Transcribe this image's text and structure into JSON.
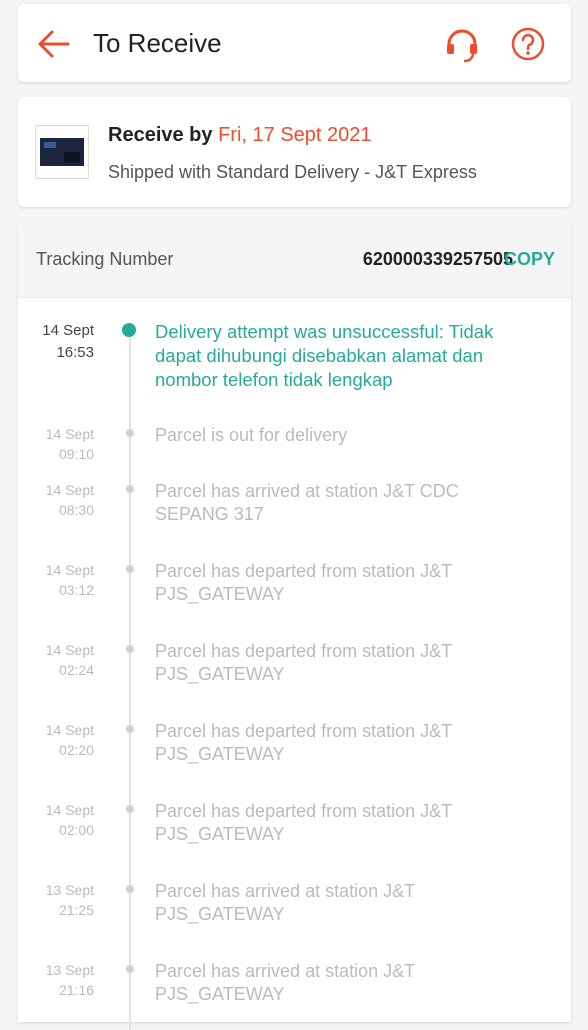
{
  "header": {
    "title": "To Receive"
  },
  "delivery": {
    "receive_by_label": "Receive by",
    "receive_date": "Fri, 17 Sept 2021",
    "shipping_text": "Shipped with Standard Delivery  - J&T Express"
  },
  "tracking": {
    "label": "Tracking Number",
    "number": "620000339257505",
    "copy_label": "COPY",
    "events": [
      {
        "date": "14 Sept",
        "time": "16:53",
        "text": "Delivery attempt was unsuccessful: Tidak dapat dihubungi disebabkan alamat dan nombor telefon tidak lengkap",
        "active": true
      },
      {
        "date": "14 Sept",
        "time": "09:10",
        "text": "Parcel is out for delivery"
      },
      {
        "date": "14 Sept",
        "time": "08:30",
        "text": "Parcel has arrived at station J&T CDC SEPANG 317"
      },
      {
        "date": "14 Sept",
        "time": "03:12",
        "text": "Parcel has departed from station J&T PJS_GATEWAY"
      },
      {
        "date": "14 Sept",
        "time": "02:24",
        "text": "Parcel has departed from station J&T PJS_GATEWAY"
      },
      {
        "date": "14 Sept",
        "time": "02:20",
        "text": "Parcel has departed from station J&T PJS_GATEWAY"
      },
      {
        "date": "14 Sept",
        "time": "02:00",
        "text": "Parcel has departed from station J&T PJS_GATEWAY"
      },
      {
        "date": "13 Sept",
        "time": "21:25",
        "text": "Parcel has arrived at station J&T PJS_GATEWAY"
      },
      {
        "date": "13 Sept",
        "time": "21:16",
        "text": "Parcel has arrived at station J&T PJS_GATEWAY"
      }
    ]
  },
  "colors": {
    "accent": "#ee4d2d",
    "success": "#26aa99"
  },
  "icons": {
    "back": "back-arrow-icon",
    "support": "headset-icon",
    "help": "help-icon"
  }
}
